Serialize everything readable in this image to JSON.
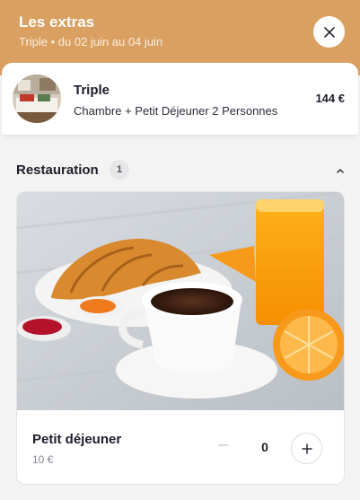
{
  "header": {
    "title": "Les extras",
    "subtitle": "Triple • du 02 juin au 04 juin",
    "close_icon": "close-icon"
  },
  "room": {
    "name": "Triple",
    "description": "Chambre + Petit Déjeuner 2 Personnes",
    "price": "144 €"
  },
  "section": {
    "title": "Restauration",
    "count": "1",
    "expanded": true
  },
  "extras": [
    {
      "name": "Petit déjeuner",
      "price": "10 €",
      "quantity": "0"
    }
  ],
  "colors": {
    "header_bg": "#d9a062",
    "background": "#f3f3f3",
    "text": "#1d1d2b"
  }
}
